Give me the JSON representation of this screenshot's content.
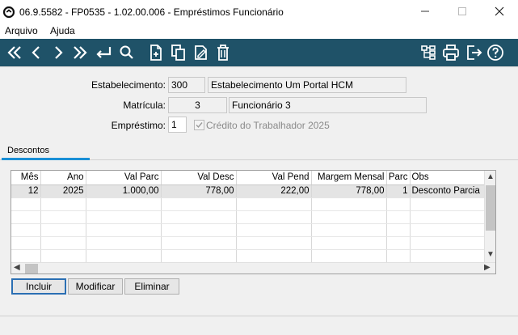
{
  "window": {
    "title": "06.9.5582 - FP0535 - 1.02.00.006 - Empréstimos Funcionário",
    "minimize_icon": "minimize-icon",
    "maximize_icon": "maximize-icon",
    "close_icon": "close-icon"
  },
  "menu": {
    "items": [
      "Arquivo",
      "Ajuda"
    ]
  },
  "toolbar": {
    "background": "#1f5268",
    "left_icons": [
      "first-record-icon",
      "previous-record-icon",
      "next-record-icon",
      "last-record-icon",
      "return-icon",
      "search-icon",
      "new-document-icon",
      "copy-icon",
      "edit-icon",
      "delete-icon"
    ],
    "right_icons": [
      "tree-structure-icon",
      "print-icon",
      "exit-icon",
      "help-icon"
    ]
  },
  "form": {
    "estabelecimento_label": "Estabelecimento:",
    "estabelecimento_code": "300",
    "estabelecimento_name": "Estabelecimento Um Portal HCM",
    "matricula_label": "Matrícula:",
    "matricula_code": "3",
    "matricula_name": "Funcionário 3",
    "emprestimo_label": "Empréstimo:",
    "emprestimo_value": "1",
    "credito_checked": true,
    "credito_label": "Crédito do Trabalhador 2025"
  },
  "tabs": {
    "descontos": "Descontos",
    "accent": "#1a8fd6"
  },
  "grid": {
    "columns": [
      "Mês",
      "Ano",
      "Val Parc",
      "Val Desc",
      "Val Pend",
      "Margem Mensal",
      "Parc",
      "Obs"
    ],
    "rows": [
      {
        "mes": "12",
        "ano": "2025",
        "val_parc": "1.000,00",
        "val_desc": "778,00",
        "val_pend": "222,00",
        "margem": "778,00",
        "parc": "1",
        "obs": "Desconto Parcia"
      }
    ]
  },
  "buttons": {
    "incluir": "Incluir",
    "modificar": "Modificar",
    "eliminar": "Eliminar"
  }
}
